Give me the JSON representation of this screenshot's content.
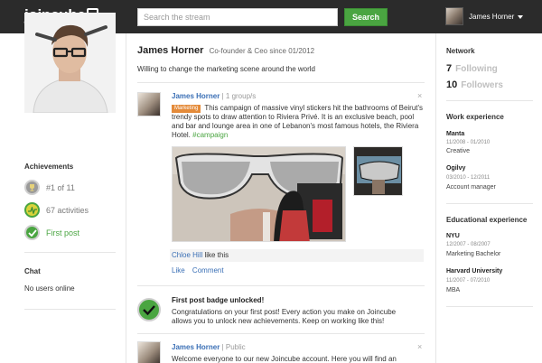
{
  "header": {
    "logo": "joincube",
    "search_placeholder": "Search the stream",
    "search_button": "Search",
    "user_name": "James Horner"
  },
  "sidebar_left": {
    "achievements_title": "Achievements",
    "achievements": [
      {
        "label": "#1 of 11",
        "icon": "trophy-icon"
      },
      {
        "label": "67 activities",
        "icon": "activity-icon"
      },
      {
        "label": "First post",
        "icon": "check-icon"
      }
    ],
    "chat_title": "Chat",
    "chat_status": "No users online"
  },
  "profile": {
    "name": "James Horner",
    "role": "Co-founder & Ceo since 01/2012",
    "tagline": "Willing to change the marketing scene around the world"
  },
  "feed": {
    "post1": {
      "author": "James Horner",
      "meta": "| 1 group/s",
      "tag": "Marketing",
      "text": "This campaign of massive vinyl stickers hit the bathrooms of Beirut's trendy spots to draw attention to Riviera Privé. It is an exclusive beach, pool and bar and lounge area in one of Lebanon's most famous hotels, the Riviera Hotel.",
      "hashtag": "#campaign",
      "liker": "Chloe Hill",
      "likes_suffix": " like this",
      "like_label": "Like",
      "comment_label": "Comment"
    },
    "badge_post": {
      "title": "First post badge unlocked!",
      "text": "Congratulations on your first post! Every action you make on Joincube allows you to unlock new achievements. Keep on working like this!"
    },
    "post2": {
      "author": "James Horner",
      "meta": "| Public",
      "text": "Welcome everyone to our new Joincube account. Here you will find an"
    }
  },
  "sidebar_right": {
    "network_title": "Network",
    "following_count": "7",
    "following_label": "Following",
    "followers_count": "10",
    "followers_label": "Followers",
    "work_title": "Work experience",
    "work": [
      {
        "company": "Manta",
        "dates": "11/2008 - 01/2010",
        "role": "Creative"
      },
      {
        "company": "Ogilvy",
        "dates": "03/2010 - 12/2011",
        "role": "Account manager"
      }
    ],
    "edu_title": "Educational experience",
    "education": [
      {
        "school": "NYU",
        "dates": "12/2007 - 08/2007",
        "role": "Marketing Bachelor"
      },
      {
        "school": "Harvard University",
        "dates": "11/2007 - 07/2010",
        "role": "MBA"
      }
    ]
  },
  "colors": {
    "topbar": "#2b2b2b",
    "accent_green": "#4aa541",
    "link_blue": "#3a6fb5",
    "tag_orange": "#e48b3a"
  }
}
